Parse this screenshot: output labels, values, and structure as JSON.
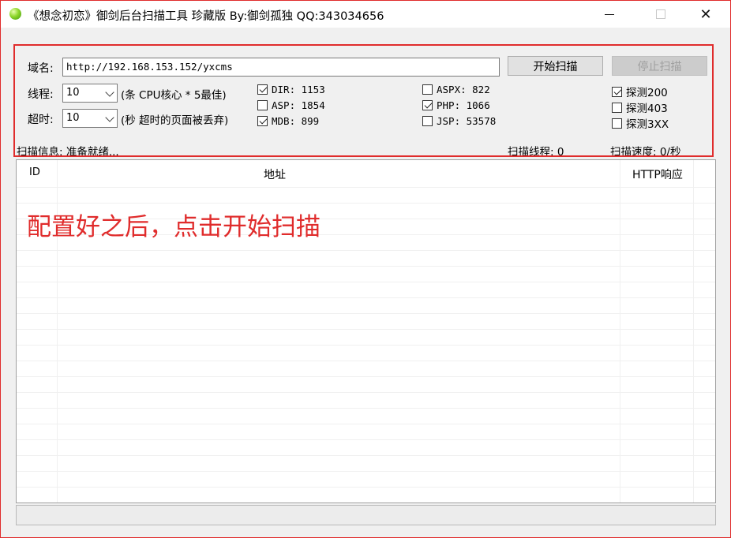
{
  "window": {
    "title": "《想念初恋》御剑后台扫描工具 珍藏版 By:御剑孤独 QQ:343034656",
    "controls": {
      "minimize": "—",
      "maximize": "☐",
      "close": "✕"
    }
  },
  "config": {
    "domain_label": "域名:",
    "domain_value": "http://192.168.153.152/yxcms",
    "start_button": "开始扫描",
    "stop_button": "停止扫描",
    "threads_label": "线程:",
    "threads_value": "10",
    "threads_hint": "(条 CPU核心 * 5最佳)",
    "timeout_label": "超时:",
    "timeout_value": "10",
    "timeout_hint": "(秒 超时的页面被丢弃)",
    "dictionaries": [
      {
        "label": "DIR: 1153",
        "checked": true
      },
      {
        "label": "ASP: 1854",
        "checked": false
      },
      {
        "label": "MDB: 899",
        "checked": true
      },
      {
        "label": "ASPX: 822",
        "checked": false
      },
      {
        "label": "PHP: 1066",
        "checked": true
      },
      {
        "label": "JSP: 53578",
        "checked": false
      }
    ],
    "probes": [
      {
        "label": "探测200",
        "checked": true
      },
      {
        "label": "探测403",
        "checked": false
      },
      {
        "label": "探测3XX",
        "checked": false
      }
    ]
  },
  "status": {
    "info": "扫描信息: 准备就绪...",
    "threads": "扫描线程: 0",
    "speed": "扫描速度: 0/秒"
  },
  "table": {
    "columns": [
      "ID",
      "地址",
      "HTTP响应"
    ],
    "rows": []
  },
  "annotation": {
    "text": "配置好之后，点击开始扫描",
    "color": "#e02c2c"
  }
}
